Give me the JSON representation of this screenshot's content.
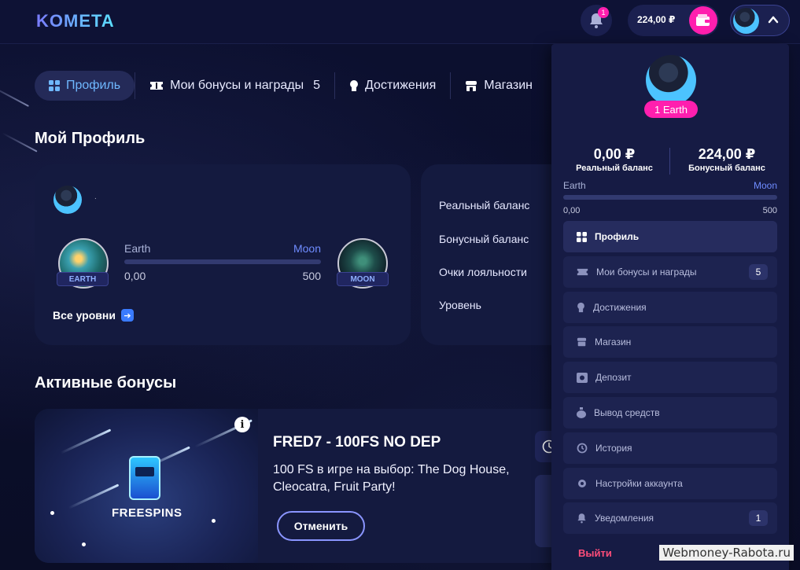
{
  "header": {
    "logo": "KOMETA",
    "notifications_badge": "1",
    "balance": "224,00 ₽"
  },
  "tabs": [
    {
      "label": "Профиль",
      "icon": "grid-icon",
      "active": true
    },
    {
      "label": "Мои бонусы и награды",
      "count": "5",
      "icon": "ticket-icon"
    },
    {
      "label": "Достижения",
      "icon": "medal-icon"
    },
    {
      "label": "Магазин",
      "icon": "shop-icon"
    }
  ],
  "profile": {
    "section_title": "Мой Профиль",
    "username": ".",
    "level_from": "Earth",
    "level_to": "Moon",
    "progress_min": "0,00",
    "progress_max": "500",
    "progress_fraction": 0,
    "earth_label": "EARTH",
    "moon_label": "MOON",
    "all_levels": "Все уровни"
  },
  "stats": {
    "real_balance_label": "Реальный баланс",
    "bonus_balance_label": "Бонусный баланс",
    "loyalty_points_label": "Очки лояльности",
    "level_label": "Уровень"
  },
  "bonuses": {
    "section_title": "Активные бонусы",
    "image_label": "FREESPINS",
    "title": "FRED7 - 100FS NO DEP",
    "description": "100 FS в игре на выбор: The Dog House, Cleocatra, Fruit Party!",
    "cancel_label": "Отменить"
  },
  "dropdown": {
    "level_pill": "1 Earth",
    "real_balance": "0,00 ₽",
    "real_balance_label": "Реальный баланс",
    "bonus_balance": "224,00 ₽",
    "bonus_balance_label": "Бонусный баланс",
    "level_from": "Earth",
    "level_to": "Moon",
    "progress_min": "0,00",
    "progress_max": "500",
    "menu": [
      {
        "label": "Профиль",
        "icon": "grid-icon",
        "active": true
      },
      {
        "label": "Мои бонусы и награды",
        "icon": "ticket-icon",
        "count": "5"
      },
      {
        "label": "Достижения",
        "icon": "medal-icon"
      },
      {
        "label": "Магазин",
        "icon": "shop-icon"
      },
      {
        "label": "Депозит",
        "icon": "deposit-icon"
      },
      {
        "label": "Вывод средств",
        "icon": "money-bag-icon"
      },
      {
        "label": "История",
        "icon": "history-icon"
      },
      {
        "label": "Настройки аккаунта",
        "icon": "gear-icon"
      },
      {
        "label": "Уведомления",
        "icon": "bell-icon",
        "count": "1"
      }
    ],
    "logout": "Выйти"
  },
  "watermark": "Webmoney-Rabota.ru",
  "colors": {
    "accent_pink": "#ff1fae",
    "accent_blue": "#6f8cff",
    "background": "#0b0f2a",
    "card": "#141a3f",
    "logout": "#ff4d7a"
  }
}
